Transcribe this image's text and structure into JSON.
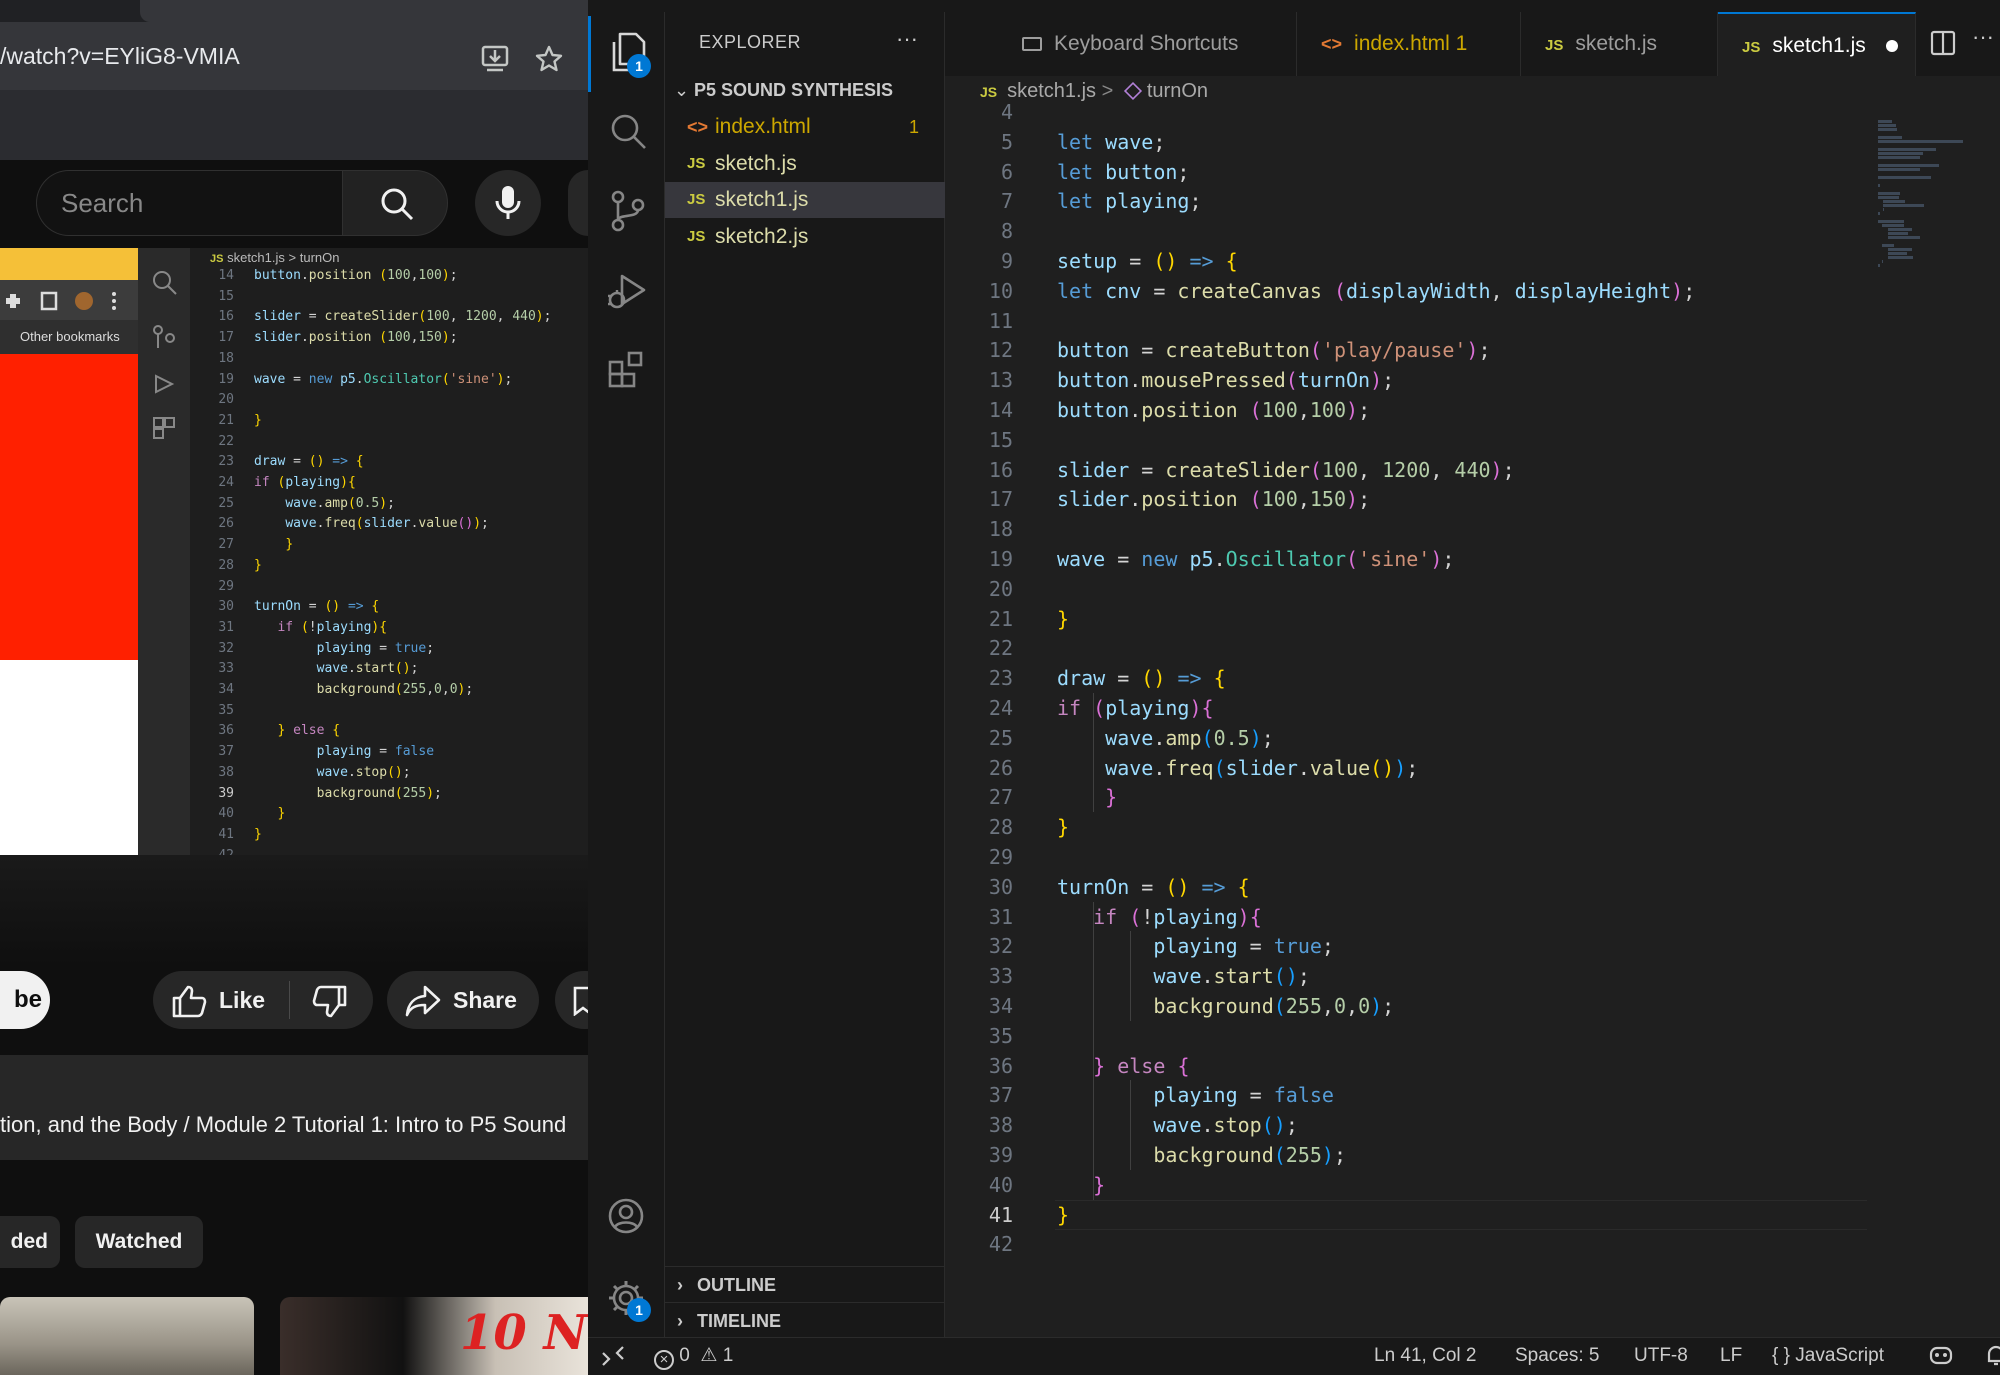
{
  "browser": {
    "url_text": "/watch?v=EYliG8-VMIA",
    "search_placeholder": "Search",
    "video": {
      "other_bookmarks": "Other bookmarks",
      "breadcrumb_file": "sketch1.js",
      "breadcrumb_symbol": "turnOn",
      "current_line": 39,
      "lines": [
        {
          "n": 14,
          "t": "button.position (100,100);"
        },
        {
          "n": 15,
          "t": ""
        },
        {
          "n": 16,
          "t": "slider = createSlider(100, 1200, 440);"
        },
        {
          "n": 17,
          "t": "slider.position (100,150);"
        },
        {
          "n": 18,
          "t": ""
        },
        {
          "n": 19,
          "t": "wave = new p5.Oscillator('sine');"
        },
        {
          "n": 20,
          "t": ""
        },
        {
          "n": 21,
          "t": "}"
        },
        {
          "n": 22,
          "t": ""
        },
        {
          "n": 23,
          "t": "draw = () => {"
        },
        {
          "n": 24,
          "t": "if (playing){"
        },
        {
          "n": 25,
          "t": "    wave.amp(0.5);"
        },
        {
          "n": 26,
          "t": "    wave.freq(slider.value());"
        },
        {
          "n": 27,
          "t": "    }"
        },
        {
          "n": 28,
          "t": "}"
        },
        {
          "n": 29,
          "t": ""
        },
        {
          "n": 30,
          "t": "turnOn = () => {"
        },
        {
          "n": 31,
          "t": "   if (!playing){"
        },
        {
          "n": 32,
          "t": "        playing = true;"
        },
        {
          "n": 33,
          "t": "        wave.start();"
        },
        {
          "n": 34,
          "t": "        background(255,0,0);"
        },
        {
          "n": 35,
          "t": ""
        },
        {
          "n": 36,
          "t": "   } else {"
        },
        {
          "n": 37,
          "t": "        playing = false"
        },
        {
          "n": 38,
          "t": "        wave.stop();"
        },
        {
          "n": 39,
          "t": "        background(255);"
        },
        {
          "n": 40,
          "t": "   }"
        },
        {
          "n": 41,
          "t": "}"
        },
        {
          "n": 42,
          "t": ""
        }
      ]
    },
    "actions": {
      "subscribe_partial": "be",
      "like": "Like",
      "share": "Share"
    },
    "description_title": "tion, and the Body / Module 2 Tutorial 1: Intro to P5 Sound",
    "chips": [
      "ded",
      "Watched"
    ],
    "thumb2_text": "10 N"
  },
  "vscode": {
    "explorer_title": "EXPLORER",
    "explorer_more": "···",
    "folder_name": "P5 SOUND SYNTHESIS",
    "activity_badges": {
      "explorer": "1",
      "settings": "1"
    },
    "files": [
      {
        "name": "index.html",
        "icon": "html",
        "problems": "1",
        "selected": false,
        "warning": true
      },
      {
        "name": "sketch.js",
        "icon": "js",
        "problems": "",
        "selected": false,
        "warning": false
      },
      {
        "name": "sketch1.js",
        "icon": "js",
        "problems": "",
        "selected": true,
        "warning": false
      },
      {
        "name": "sketch2.js",
        "icon": "js",
        "problems": "",
        "selected": false,
        "warning": false
      }
    ],
    "tabs": [
      {
        "label": "Keyboard Shortcuts",
        "icon": "keyboard"
      },
      {
        "label": "index.html 1",
        "icon": "html"
      },
      {
        "label": "sketch.js",
        "icon": "js"
      },
      {
        "label": "sketch1.js",
        "icon": "js",
        "dirty": true
      }
    ],
    "breadcrumb": {
      "file": "sketch1.js",
      "symbol": "turnOn"
    },
    "code_lines": [
      {
        "n": 4,
        "code": ""
      },
      {
        "n": 5,
        "code": "let wave;"
      },
      {
        "n": 6,
        "code": "let button;"
      },
      {
        "n": 7,
        "code": "let playing;"
      },
      {
        "n": 8,
        "code": ""
      },
      {
        "n": 9,
        "code": "setup = () => {"
      },
      {
        "n": 10,
        "code": "let cnv = createCanvas (displayWidth, displayHeight);"
      },
      {
        "n": 11,
        "code": ""
      },
      {
        "n": 12,
        "code": "button = createButton('play/pause');"
      },
      {
        "n": 13,
        "code": "button.mousePressed(turnOn);"
      },
      {
        "n": 14,
        "code": "button.position (100,100);"
      },
      {
        "n": 15,
        "code": ""
      },
      {
        "n": 16,
        "code": "slider = createSlider(100, 1200, 440);"
      },
      {
        "n": 17,
        "code": "slider.position (100,150);"
      },
      {
        "n": 18,
        "code": ""
      },
      {
        "n": 19,
        "code": "wave = new p5.Oscillator('sine');"
      },
      {
        "n": 20,
        "code": ""
      },
      {
        "n": 21,
        "code": "}"
      },
      {
        "n": 22,
        "code": ""
      },
      {
        "n": 23,
        "code": "draw = () => {"
      },
      {
        "n": 24,
        "code": "if (playing){"
      },
      {
        "n": 25,
        "code": "    wave.amp(0.5);"
      },
      {
        "n": 26,
        "code": "    wave.freq(slider.value());"
      },
      {
        "n": 27,
        "code": "    }"
      },
      {
        "n": 28,
        "code": "}"
      },
      {
        "n": 29,
        "code": ""
      },
      {
        "n": 30,
        "code": "turnOn = () => {"
      },
      {
        "n": 31,
        "code": "   if (!playing){"
      },
      {
        "n": 32,
        "code": "        playing = true;"
      },
      {
        "n": 33,
        "code": "        wave.start();"
      },
      {
        "n": 34,
        "code": "        background(255,0,0);"
      },
      {
        "n": 35,
        "code": ""
      },
      {
        "n": 36,
        "code": "   } else {"
      },
      {
        "n": 37,
        "code": "        playing = false"
      },
      {
        "n": 38,
        "code": "        wave.stop();"
      },
      {
        "n": 39,
        "code": "        background(255);"
      },
      {
        "n": 40,
        "code": "   }"
      },
      {
        "n": 41,
        "code": "}"
      },
      {
        "n": 42,
        "code": ""
      }
    ],
    "current_line": 41,
    "outline_label": "OUTLINE",
    "timeline_label": "TIMELINE",
    "status": {
      "errors": "0",
      "warnings": "1",
      "position": "Ln 41, Col 2",
      "spaces": "Spaces: 5",
      "encoding": "UTF-8",
      "eol": "LF",
      "language_braces": "{ }",
      "language": "JavaScript"
    }
  },
  "colors": {
    "accent": "#0078d4",
    "keyword": "#569cd6",
    "control": "#c586c0",
    "variable": "#9cdcfe",
    "function": "#dcdcaa",
    "string": "#ce9178",
    "number": "#b5cea8",
    "warning": "#cca700"
  }
}
